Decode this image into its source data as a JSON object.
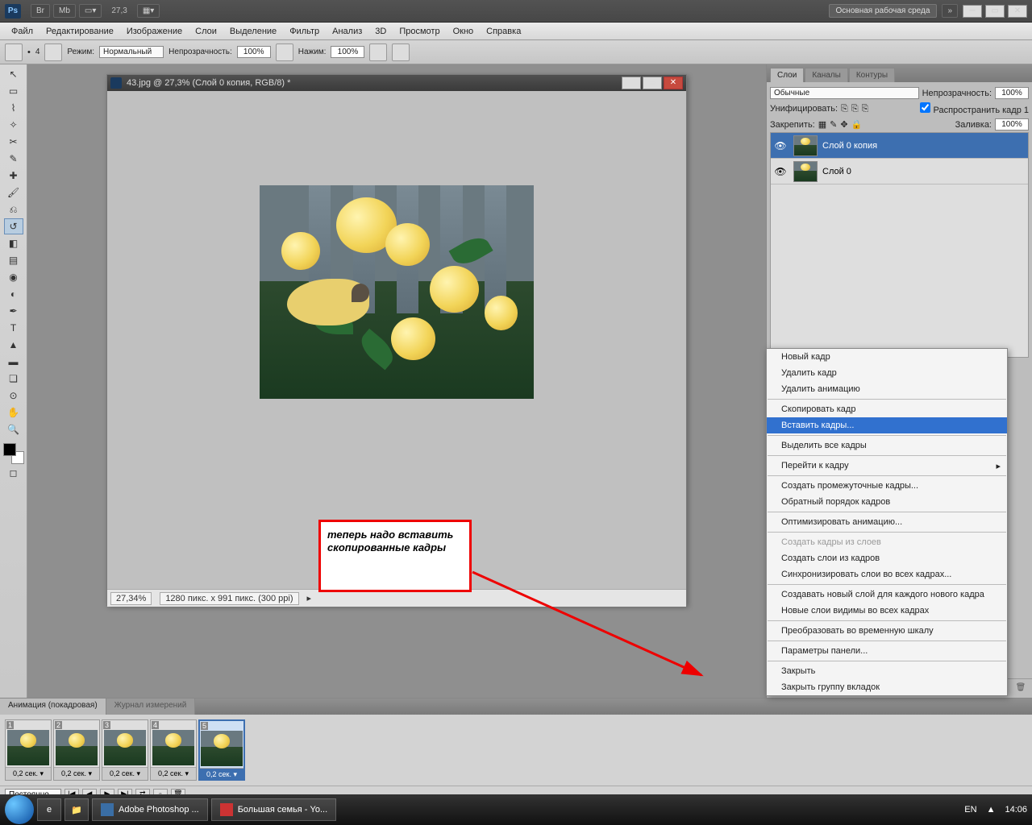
{
  "topbar": {
    "zoom": "27,3",
    "workspace": "Основная рабочая среда"
  },
  "menu": [
    "Файл",
    "Редактирование",
    "Изображение",
    "Слои",
    "Выделение",
    "Фильтр",
    "Анализ",
    "3D",
    "Просмотр",
    "Окно",
    "Справка"
  ],
  "options": {
    "size_label": "4",
    "mode_label": "Режим:",
    "mode_value": "Нормальный",
    "opacity_label": "Непрозрачность:",
    "opacity_value": "100%",
    "flow_label": "Нажим:",
    "flow_value": "100%"
  },
  "doc": {
    "title": "43.jpg @ 27,3% (Слой 0 копия, RGB/8) *",
    "status_zoom": "27,34%",
    "status_dims": "1280 пикс. x 991 пикс. (300 ppi)"
  },
  "layers_panel": {
    "tabs": [
      "Слои",
      "Каналы",
      "Контуры"
    ],
    "blend": "Обычные",
    "opacity_label": "Непрозрачность:",
    "opacity_value": "100%",
    "unify_label": "Унифицировать:",
    "propagate_label": "Распространить кадр 1",
    "lock_label": "Закрепить:",
    "fill_label": "Заливка:",
    "fill_value": "100%",
    "layers": [
      {
        "name": "Слой 0 копия",
        "sel": true
      },
      {
        "name": "Слой 0",
        "sel": false
      }
    ]
  },
  "annotation": "теперь надо вставить скопированные кадры",
  "context_menu": [
    {
      "t": "Новый кадр"
    },
    {
      "t": "Удалить кадр"
    },
    {
      "t": "Удалить анимацию"
    },
    {
      "sep": true
    },
    {
      "t": "Скопировать кадр"
    },
    {
      "t": "Вставить кадры...",
      "sel": true
    },
    {
      "sep": true
    },
    {
      "t": "Выделить все кадры"
    },
    {
      "sep": true
    },
    {
      "t": "Перейти к кадру",
      "arrow": true
    },
    {
      "sep": true
    },
    {
      "t": "Создать промежуточные кадры..."
    },
    {
      "t": "Обратный порядок кадров"
    },
    {
      "sep": true
    },
    {
      "t": "Оптимизировать анимацию..."
    },
    {
      "sep": true
    },
    {
      "t": "Создать кадры из слоев",
      "disabled": true
    },
    {
      "t": "Создать слои из кадров"
    },
    {
      "t": "Синхронизировать слои во всех кадрах..."
    },
    {
      "sep": true
    },
    {
      "t": "Создавать новый слой для каждого нового кадра"
    },
    {
      "t": "Новые слои видимы во всех кадрах"
    },
    {
      "sep": true
    },
    {
      "t": "Преобразовать во временную шкалу"
    },
    {
      "sep": true
    },
    {
      "t": "Параметры панели..."
    },
    {
      "sep": true
    },
    {
      "t": "Закрыть"
    },
    {
      "t": "Закрыть группу вкладок"
    }
  ],
  "animation": {
    "tabs": [
      "Анимация (покадровая)",
      "Журнал измерений"
    ],
    "frames": [
      {
        "n": "1",
        "dur": "0,2 сек."
      },
      {
        "n": "2",
        "dur": "0,2 сек."
      },
      {
        "n": "3",
        "dur": "0,2 сек."
      },
      {
        "n": "4",
        "dur": "0,2 сек."
      },
      {
        "n": "5",
        "dur": "0,2 сек.",
        "sel": true
      }
    ],
    "loop": "Постоянно"
  },
  "taskbar": {
    "items": [
      {
        "label": "Adobe Photoshop ...",
        "ico": "ps"
      },
      {
        "label": "Большая семья - Yo...",
        "ico": "op"
      }
    ],
    "lang": "EN",
    "time": "14:06"
  }
}
